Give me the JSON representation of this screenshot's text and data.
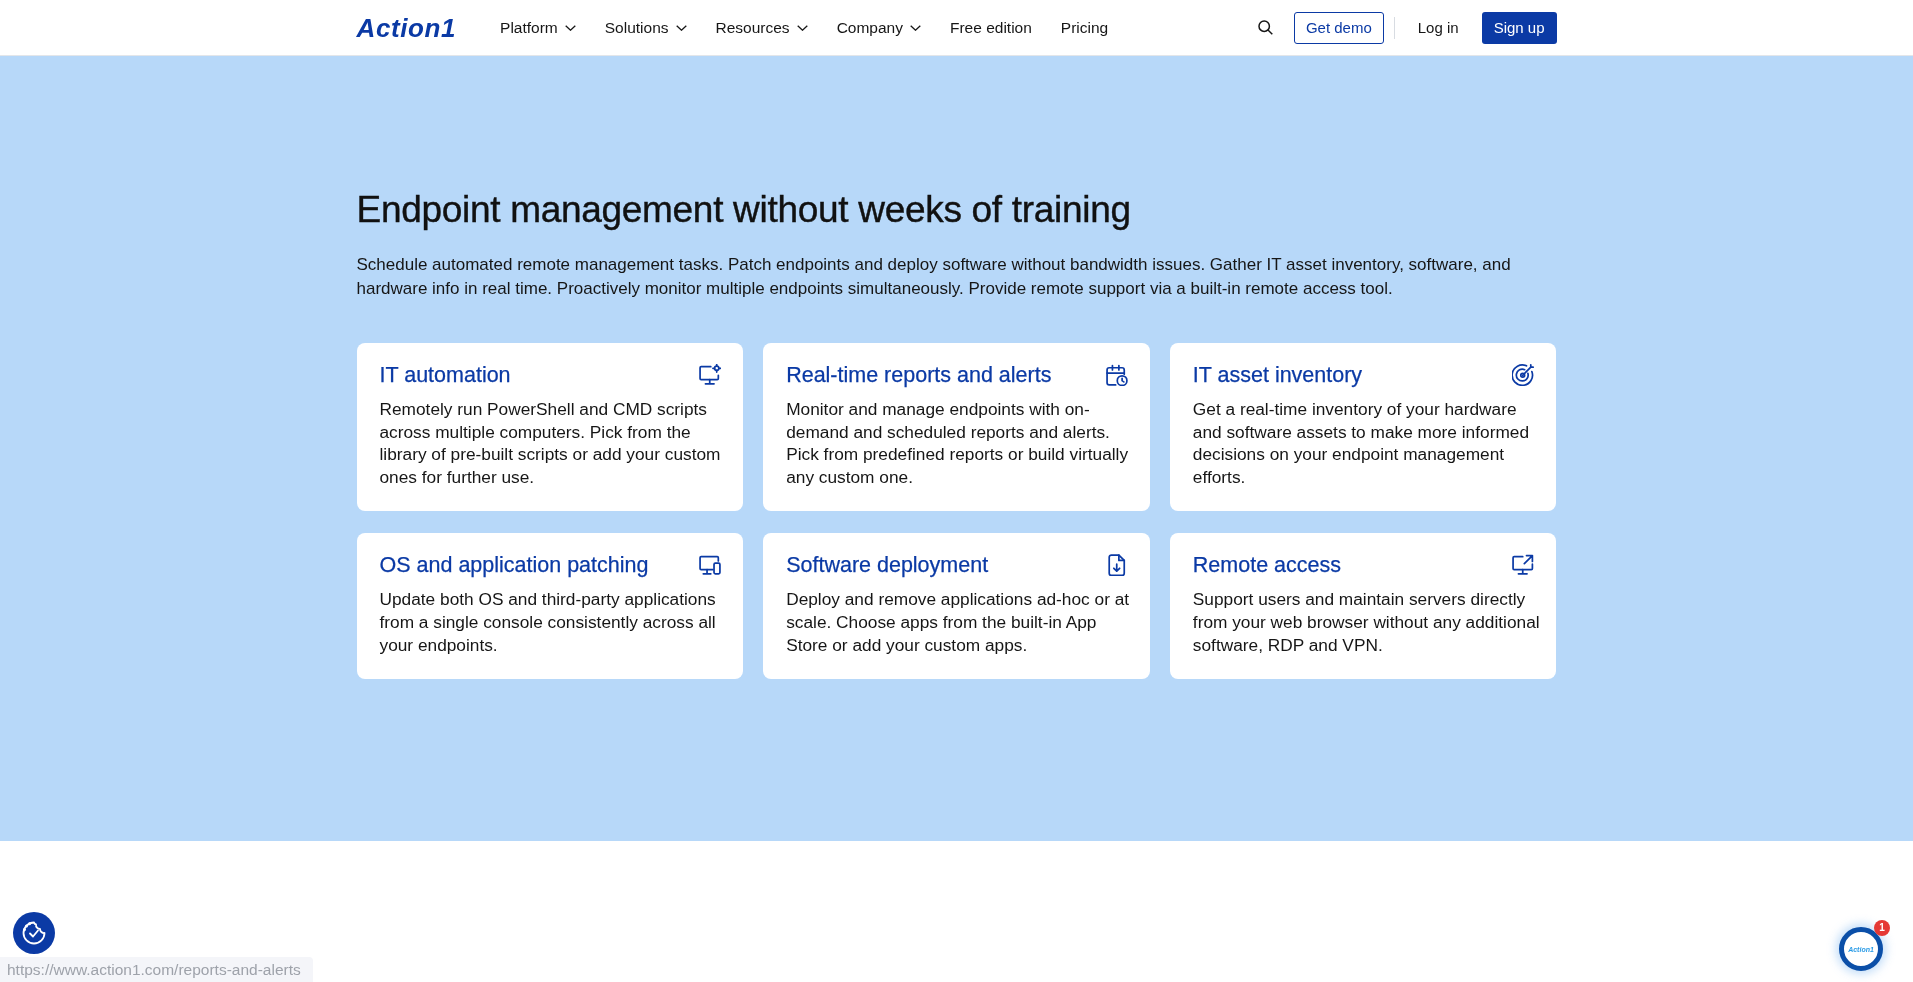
{
  "header": {
    "logo": "Action1",
    "nav": [
      {
        "label": "Platform",
        "dropdown": true
      },
      {
        "label": "Solutions",
        "dropdown": true
      },
      {
        "label": "Resources",
        "dropdown": true
      },
      {
        "label": "Company",
        "dropdown": true
      },
      {
        "label": "Free edition",
        "dropdown": false
      },
      {
        "label": "Pricing",
        "dropdown": false
      }
    ],
    "actions": [
      {
        "label": "Get demo",
        "kind": "outline"
      },
      {
        "label": "Log in",
        "kind": "text"
      },
      {
        "label": "Sign up",
        "kind": "primary"
      }
    ]
  },
  "hero": {
    "title": "Endpoint management without weeks of training",
    "description": "Schedule automated remote management tasks. Patch endpoints and deploy software without bandwidth issues. Gather IT asset inventory, software, and hardware info in real time. Proactively monitor multiple endpoints simultaneously. Provide remote support via a built-in remote access tool."
  },
  "features": [
    {
      "title": "IT automation",
      "description": "Remotely run PowerShell and CMD scripts across multiple computers. Pick from the library of pre-built scripts or add your custom ones for further use."
    },
    {
      "title": "Real-time reports and alerts",
      "description": "Monitor and manage endpoints with on-demand and scheduled reports and alerts. Pick from predefined reports or build virtually any custom one."
    },
    {
      "title": "IT asset inventory",
      "description": "Get a real-time inventory of your hardware and software assets to make more informed decisions on your endpoint management efforts."
    },
    {
      "title": "OS and application patching",
      "description": "Update both OS and third-party applications from a single console consistently across all your endpoints."
    },
    {
      "title": "Software deployment",
      "description": "Deploy and remove applications ad-hoc or at scale. Choose apps from the built-in App Store or add your custom apps."
    },
    {
      "title": "Remote access",
      "description": "Support users and maintain servers directly from your web browser without any additional software, RDP and VPN."
    }
  ],
  "chat_widget": {
    "logo": "Action1",
    "badge": "1"
  },
  "status_bar": {
    "url": "https://www.action1.com/reports-and-alerts"
  }
}
